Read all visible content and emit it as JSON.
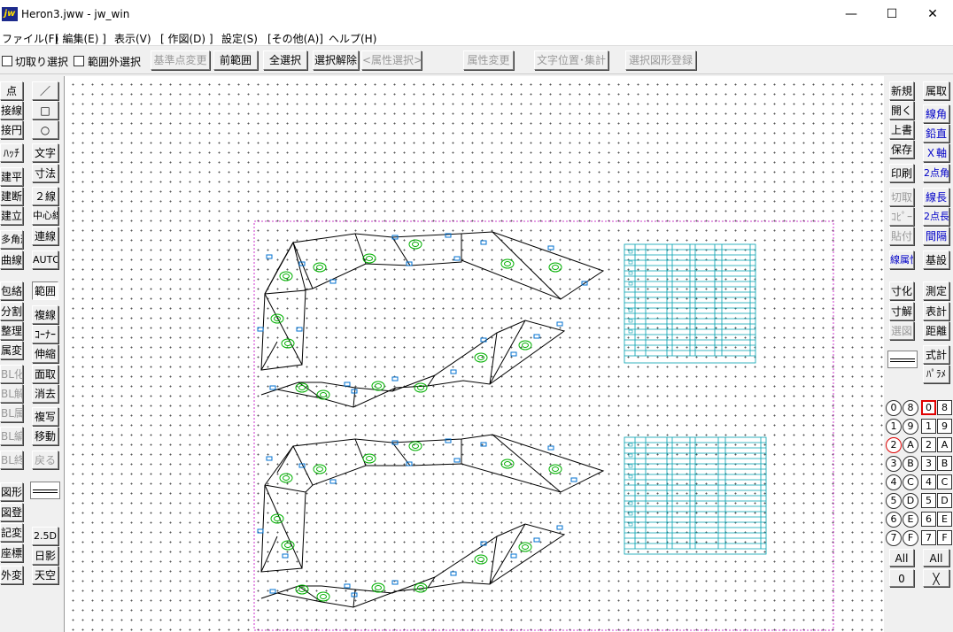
{
  "window": {
    "icon_text": "jw",
    "title": "Heron3.jww - jw_win",
    "minimize": "—",
    "maximize": "☐",
    "close": "✕"
  },
  "menu": [
    "ファイル(F)",
    "[ 編集(E) ]",
    "表示(V)",
    "[ 作図(D) ]",
    "設定(S)",
    "[その他(A)]",
    "ヘルプ(H)"
  ],
  "toolbar": {
    "checkbox1": "切取り選択",
    "checkbox2": "範囲外選択",
    "buttons": [
      "基準点変更",
      "前範囲",
      "全選択",
      "選択解除",
      "<属性選択>",
      "属性変更",
      "文字位置･集計",
      "選択図形登録"
    ]
  },
  "left_col1": [
    "点",
    "接線",
    "接円",
    "ﾊｯﾁ",
    "建平",
    "建断",
    "建立",
    "多角形",
    "曲線",
    "包絡",
    "分割",
    "整理",
    "属変",
    "BL化",
    "BL解",
    "BL属",
    "BL編",
    "BL終",
    "図形",
    "図登",
    "記変",
    "座標",
    "外変"
  ],
  "left_col2": [
    "／",
    "□",
    "○",
    "文字",
    "寸法",
    "２線",
    "中心線",
    "連線",
    "AUTO",
    "範囲",
    "複線",
    "ｺｰﾅｰ",
    "伸縮",
    "面取",
    "消去",
    "複写",
    "移動",
    "戻る",
    "2.5D",
    "日影",
    "天空"
  ],
  "right_col1": [
    "新規",
    "開く",
    "上書",
    "保存",
    "印刷",
    "切取",
    "ｺﾋﾟｰ",
    "貼付",
    "線属性",
    "寸化",
    "寸解",
    "選図",
    "All",
    "0"
  ],
  "right_col2": [
    "属取",
    "線角",
    "鉛直",
    "Ｘ軸",
    "2点角",
    "線長",
    "2点長",
    "間隔",
    "基設",
    "測定",
    "表計",
    "距離",
    "式計",
    "ﾊﾟﾗﾒ",
    "All",
    "╳"
  ],
  "layers_circle": [
    "0",
    "8",
    "1",
    "9",
    "2",
    "A",
    "3",
    "B",
    "4",
    "C",
    "5",
    "D",
    "6",
    "E",
    "7",
    "F"
  ],
  "layers_square": [
    "0",
    "8",
    "1",
    "9",
    "2",
    "A",
    "3",
    "B",
    "4",
    "C",
    "5",
    "D",
    "6",
    "E",
    "7",
    "F"
  ],
  "colors": {
    "drawing": "#000000",
    "table": "#00a0b0",
    "marker": "#00b000",
    "tag": "#0070d0",
    "dotted_frame": "#c000c0",
    "active_layer": "#e00000"
  }
}
